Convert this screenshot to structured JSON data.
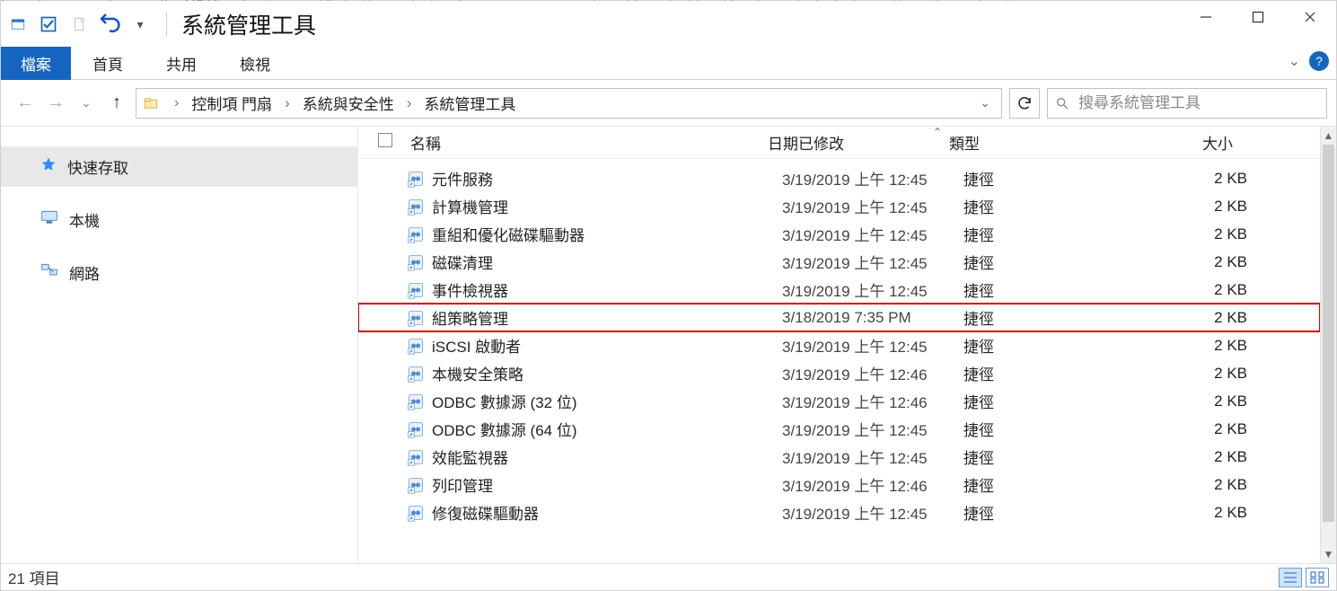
{
  "window": {
    "title": "系統管理工具"
  },
  "qat": {
    "undo": "↶"
  },
  "ribbon": {
    "file": "檔案",
    "tabs": [
      "首頁",
      "共用",
      "檢視"
    ]
  },
  "breadcrumb": {
    "segments": [
      "控制項 門扇",
      "系統與安全性",
      "系統管理工具"
    ]
  },
  "search": {
    "placeholder": "搜尋系統管理工具"
  },
  "navpane": {
    "quick": "快速存取",
    "pc": "本機",
    "network": "網路"
  },
  "columns": {
    "name": "名稱",
    "date": "日期已修改",
    "type": "類型",
    "size": "大小"
  },
  "rows": [
    {
      "name": "元件服務",
      "date": "3/19/2019 上午 12:45",
      "type": "捷徑",
      "size": "2 KB",
      "hl": false
    },
    {
      "name": "計算機管理",
      "date": "3/19/2019 上午 12:45",
      "type": "捷徑",
      "size": "2 KB",
      "hl": false
    },
    {
      "name": "重組和優化磁碟驅動器",
      "date": "3/19/2019 上午 12:45",
      "type": "捷徑",
      "size": "2 KB",
      "hl": false
    },
    {
      "name": "磁碟清理",
      "date": "3/19/2019 上午 12:45",
      "type": "捷徑",
      "size": "2 KB",
      "hl": false
    },
    {
      "name": "事件檢視器",
      "date": "3/19/2019 上午 12:45",
      "type": "捷徑",
      "size": "2 KB",
      "hl": false
    },
    {
      "name": "組策略管理",
      "date": "3/18/2019 7:35 PM",
      "type": "捷徑",
      "size": "2 KB",
      "hl": true
    },
    {
      "name": "iSCSI 啟動者",
      "date": "3/19/2019 上午 12:45",
      "type": "捷徑",
      "size": "2 KB",
      "hl": false
    },
    {
      "name": "本機安全策略",
      "date": "3/19/2019 上午 12:46",
      "type": "捷徑",
      "size": "2 KB",
      "hl": false
    },
    {
      "name": "ODBC 數據源 (32 位)",
      "date": "3/19/2019 上午 12:46",
      "type": "捷徑",
      "size": "2 KB",
      "hl": false
    },
    {
      "name": "ODBC 數據源 (64 位)",
      "date": "3/19/2019 上午 12:45",
      "type": "捷徑",
      "size": "2 KB",
      "hl": false
    },
    {
      "name": "效能監視器",
      "date": "3/19/2019 上午 12:45",
      "type": "捷徑",
      "size": "2 KB",
      "hl": false
    },
    {
      "name": "列印管理",
      "date": "3/19/2019 上午 12:46",
      "type": "捷徑",
      "size": "2 KB",
      "hl": false
    },
    {
      "name": "修復磁碟驅動器",
      "date": "3/19/2019 上午 12:45",
      "type": "捷徑",
      "size": "2 KB",
      "hl": false
    }
  ],
  "status": {
    "count": "21 項目"
  }
}
